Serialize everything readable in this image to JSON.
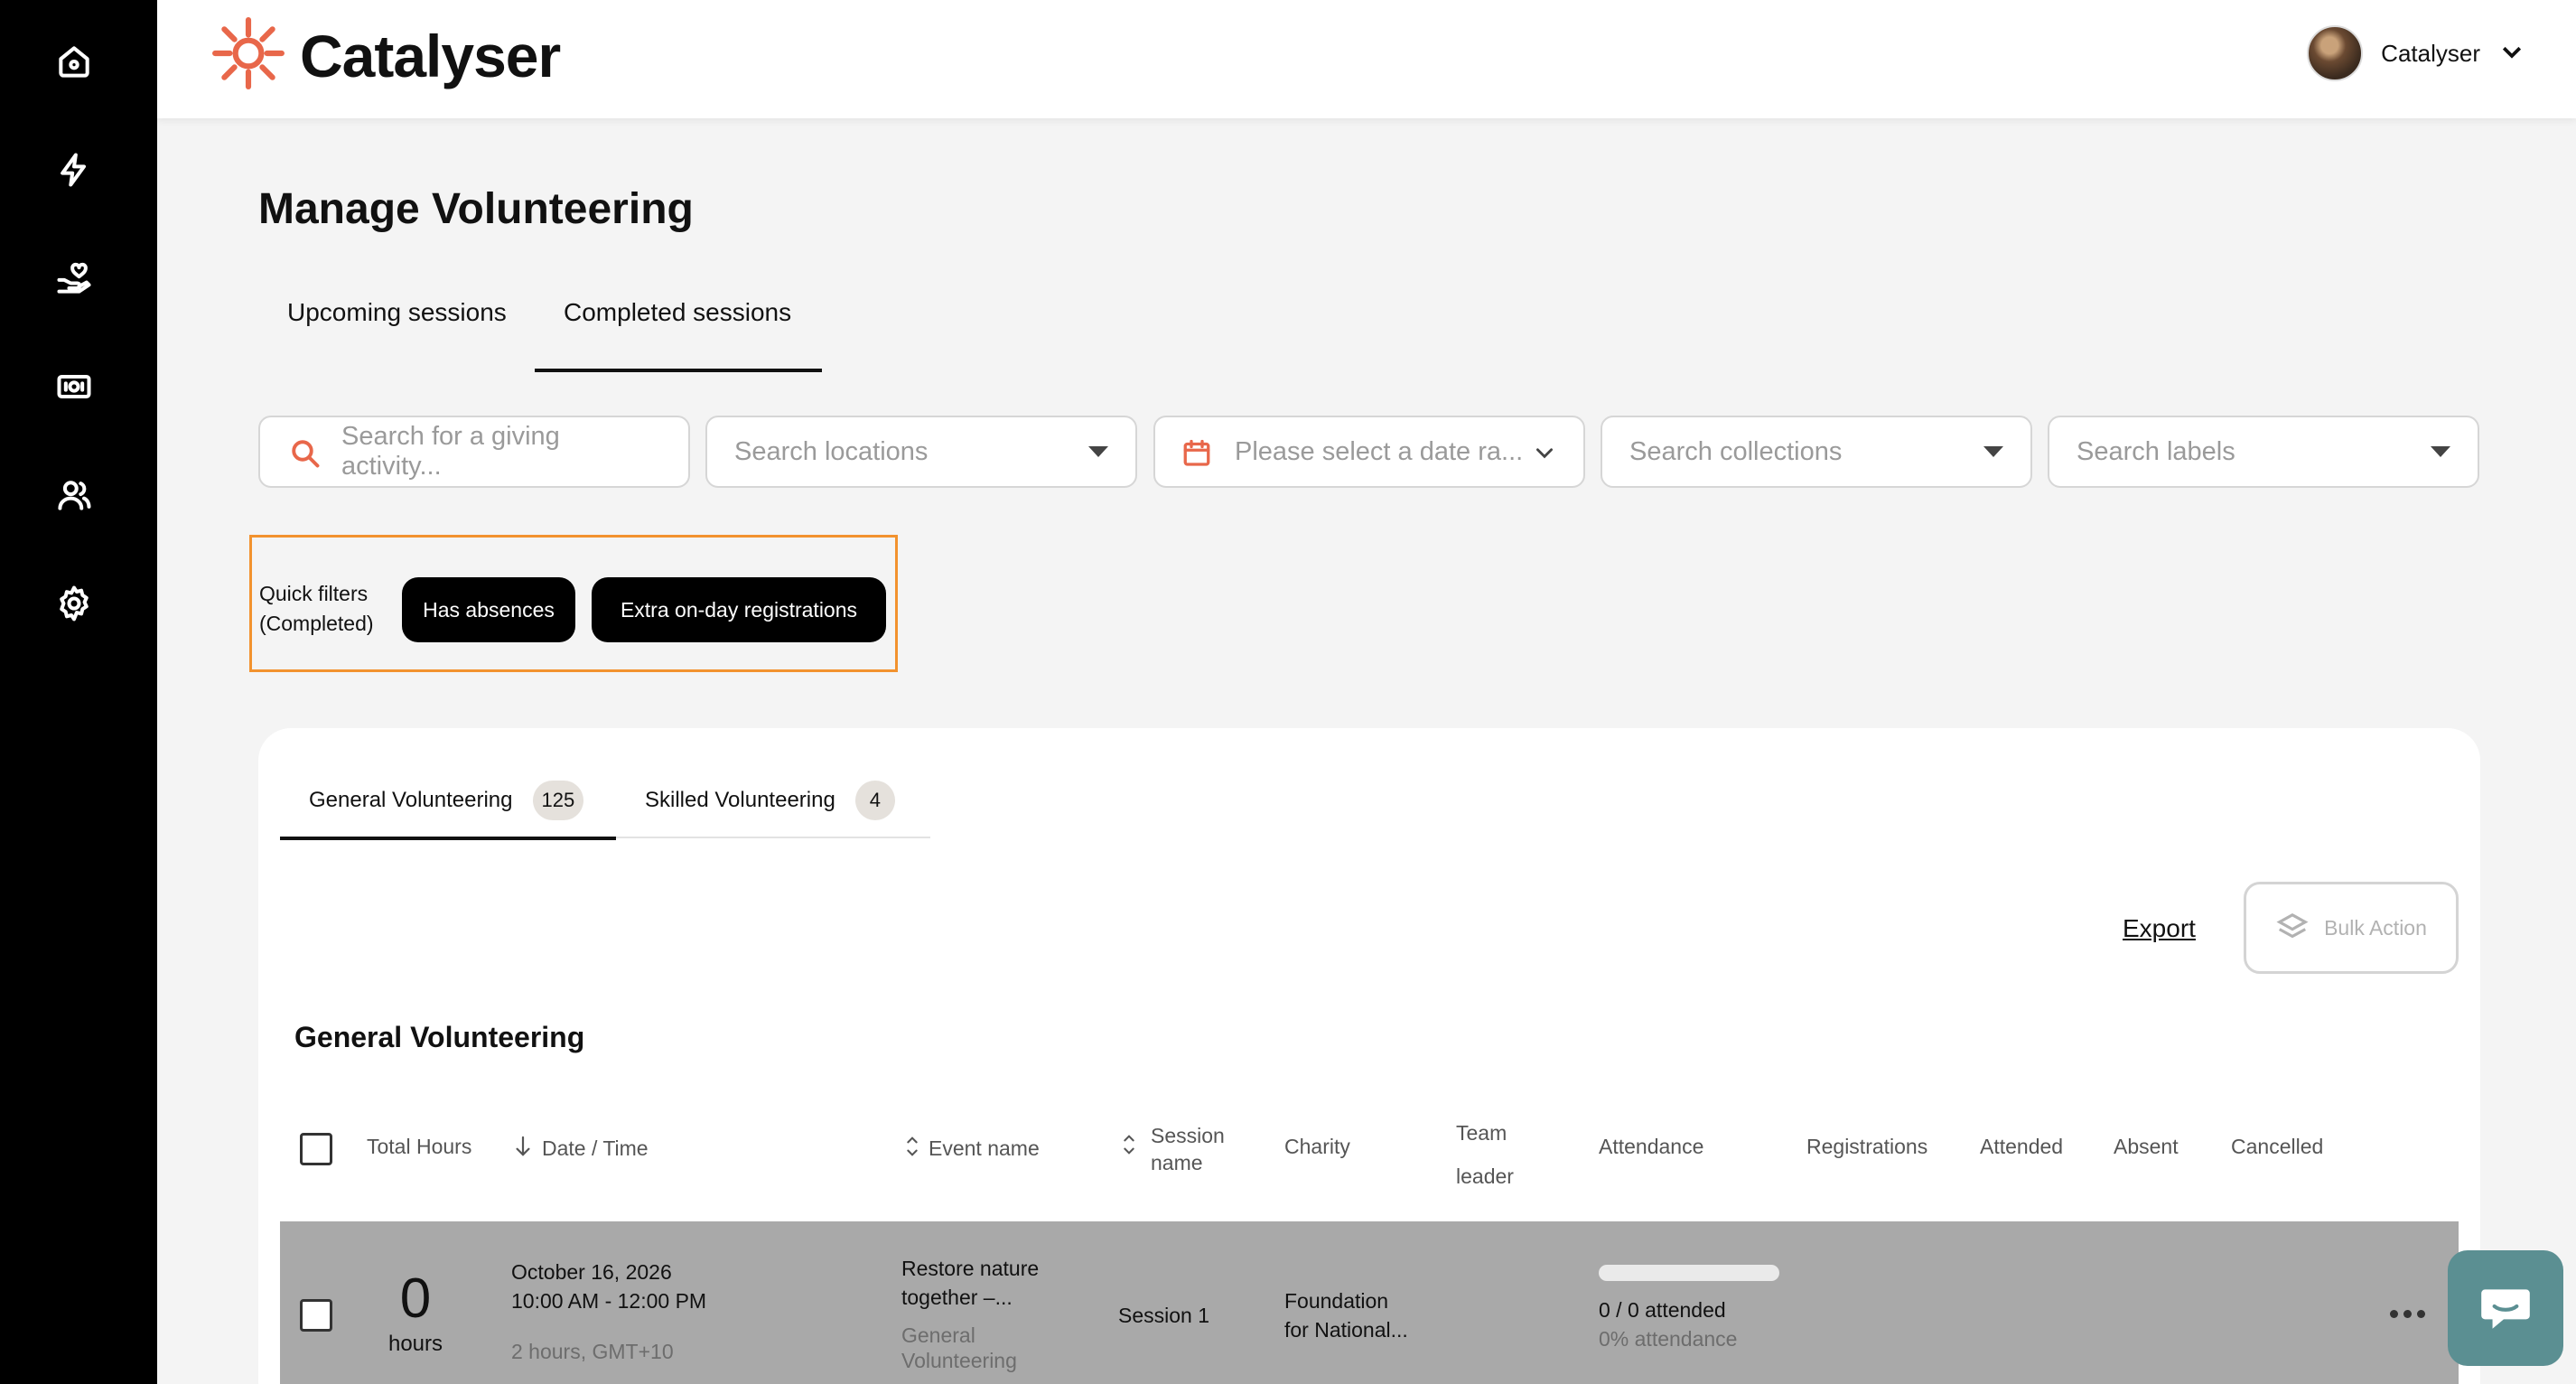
{
  "app": {
    "brand": "Catalyser",
    "accent_color": "#e8674a"
  },
  "sidebar": {
    "items": [
      {
        "icon": "home-icon"
      },
      {
        "icon": "lightning-icon"
      },
      {
        "icon": "giving-hand-icon"
      },
      {
        "icon": "payments-icon"
      },
      {
        "icon": "people-icon"
      },
      {
        "icon": "settings-gear-icon"
      }
    ]
  },
  "header": {
    "user_name": "Catalyser"
  },
  "page": {
    "title": "Manage Volunteering",
    "tabs": [
      {
        "label": "Upcoming sessions",
        "active": false
      },
      {
        "label": "Completed sessions",
        "active": true
      }
    ]
  },
  "filters": {
    "search_placeholder": "Search for a giving activity...",
    "locations_placeholder": "Search locations",
    "date_placeholder": "Please select a date ra...",
    "collections_placeholder": "Search collections",
    "labels_placeholder": "Search labels"
  },
  "quick_filters": {
    "label_line1": "Quick filters",
    "label_line2": "(Completed)",
    "chips": [
      "Has absences",
      "Extra on-day registrations"
    ],
    "highlight_color": "#f2922e"
  },
  "card": {
    "tabs": [
      {
        "label": "General Volunteering",
        "count": "125",
        "active": true
      },
      {
        "label": "Skilled Volunteering",
        "count": "4",
        "active": false
      }
    ],
    "export_label": "Export",
    "bulk_action_label": "Bulk Action",
    "section_title": "General Volunteering",
    "columns": {
      "total_hours": "Total Hours",
      "date_time": "Date / Time",
      "event_name": "Event name",
      "session_name_1": "Session",
      "session_name_2": "name",
      "charity": "Charity",
      "team_leader_1": "Team",
      "team_leader_2": "leader",
      "attendance": "Attendance",
      "registrations": "Registrations",
      "attended": "Attended",
      "absent": "Absent",
      "cancelled": "Cancelled"
    },
    "rows": [
      {
        "hours": "0",
        "hours_unit": "hours",
        "date": "October 16, 2026",
        "time": "10:00 AM - 12:00 PM",
        "duration": "2 hours, GMT+10",
        "event_line1": "Restore nature",
        "event_line2": "together –...",
        "event_category_line1": "General",
        "event_category_line2": "Volunteering",
        "session": "Session 1",
        "charity_line1": "Foundation",
        "charity_line2": "for National...",
        "attendance_progress": 0,
        "attended_text": "0 / 0 attended",
        "attendance_pct": "0% attendance"
      }
    ]
  }
}
